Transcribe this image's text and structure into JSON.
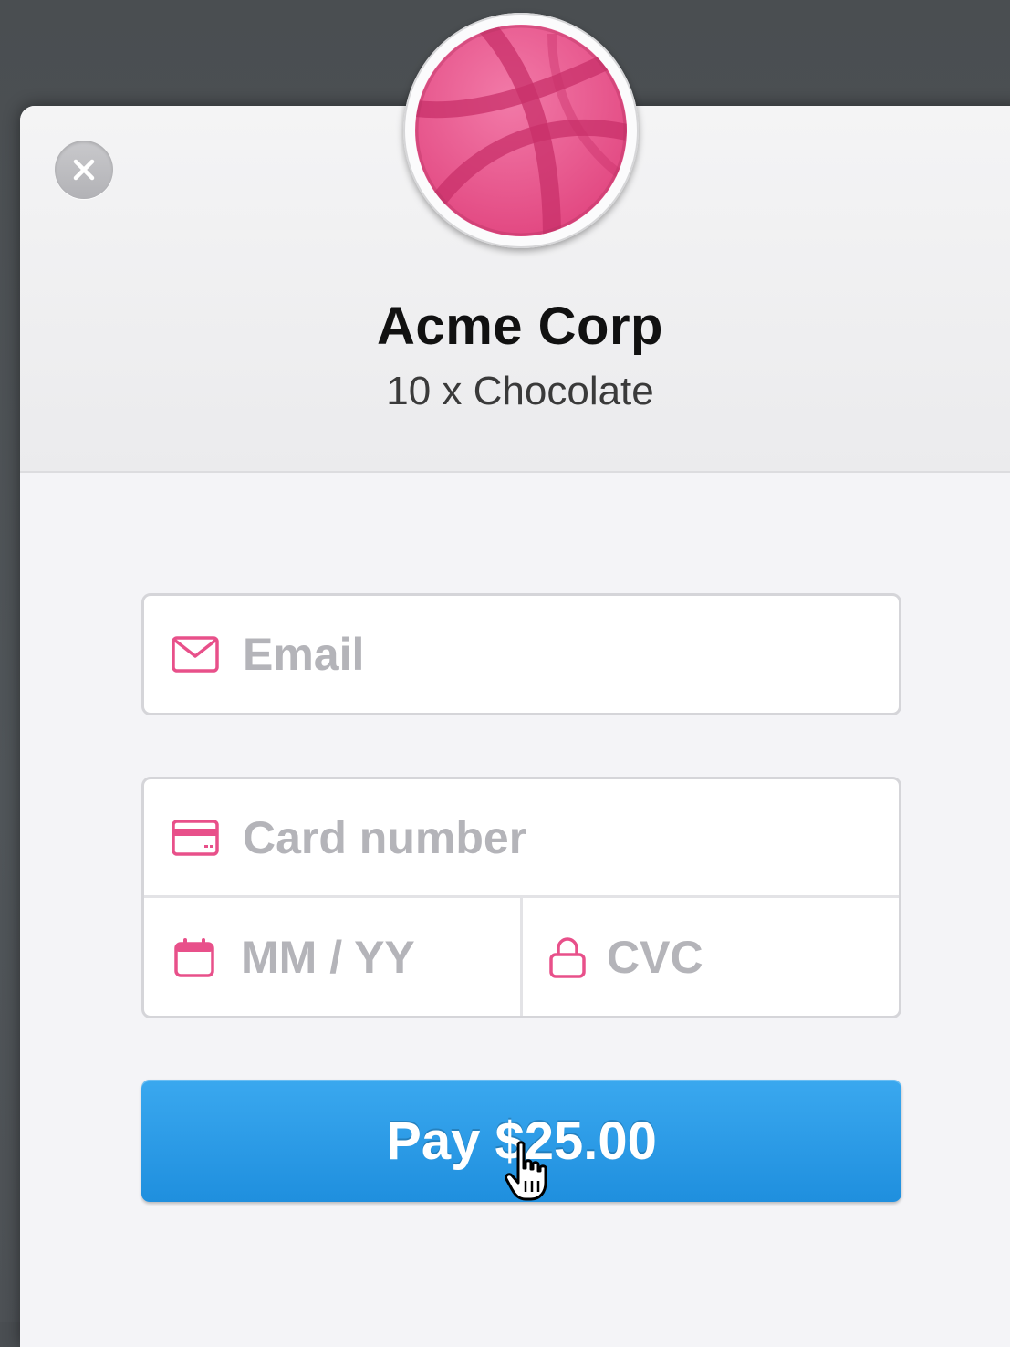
{
  "checkout": {
    "merchant_name": "Acme Corp",
    "description": "10 x Chocolate",
    "logo_icon": "dribbble-ball-logo",
    "close_icon": "close-icon"
  },
  "form": {
    "email": {
      "placeholder": "Email",
      "value": "",
      "icon": "envelope-icon"
    },
    "card_number": {
      "placeholder": "Card number",
      "value": "",
      "icon": "credit-card-icon"
    },
    "expiry": {
      "placeholder": "MM / YY",
      "value": "",
      "icon": "calendar-icon"
    },
    "cvc": {
      "placeholder": "CVC",
      "value": "",
      "icon": "lock-icon"
    }
  },
  "pay_button": {
    "label": "Pay $25.00"
  },
  "colors": {
    "accent_pink": "#e8508a",
    "pay_blue": "#2a9be8",
    "backdrop": "#4a4e52"
  }
}
